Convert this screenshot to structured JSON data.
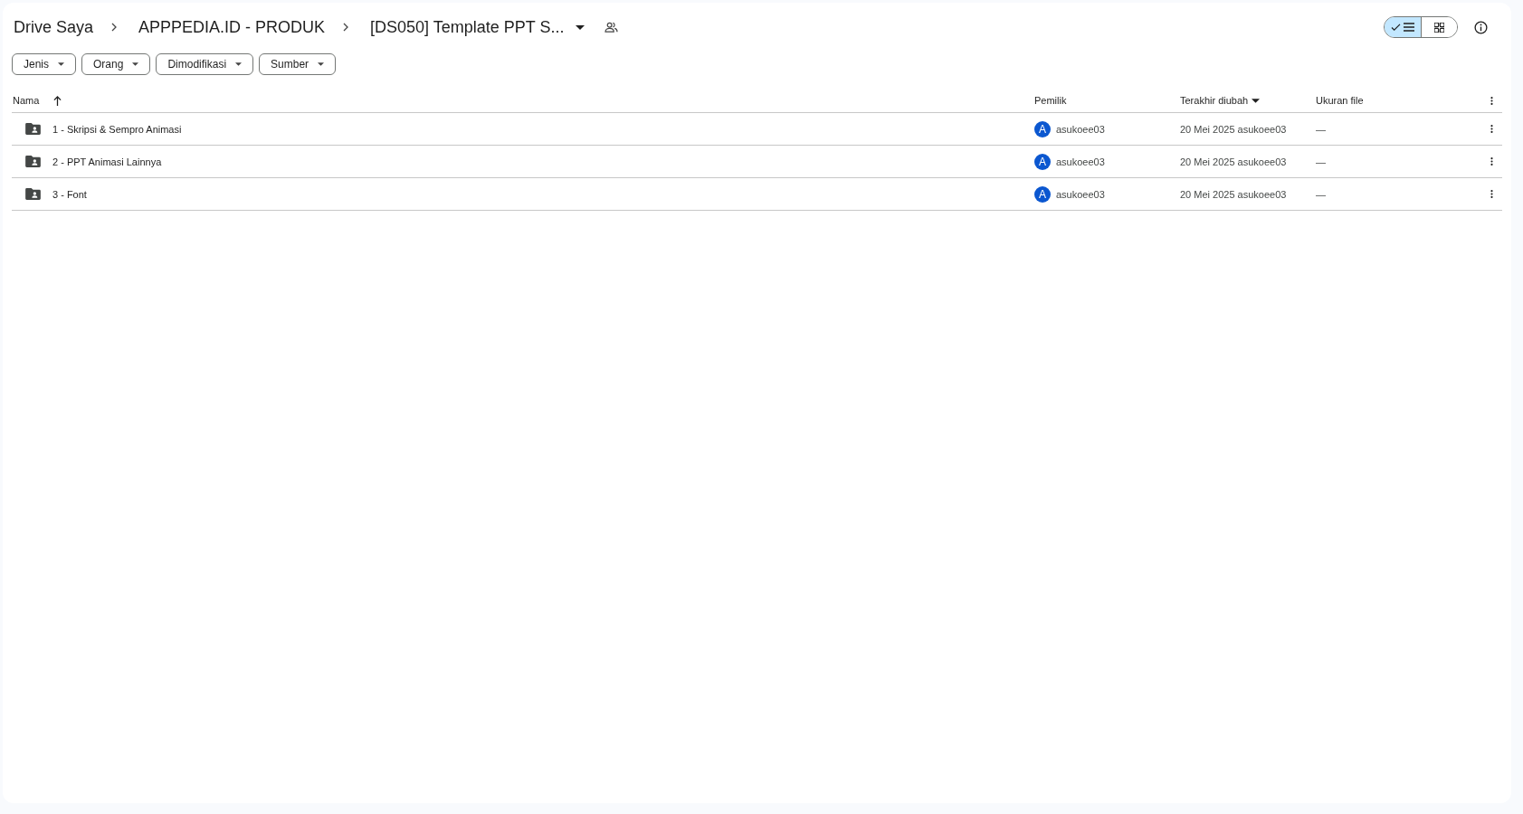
{
  "breadcrumb": [
    {
      "label": "Drive Saya",
      "menu": false
    },
    {
      "label": "APPPEDIA.ID - PRODUK",
      "menu": false
    },
    {
      "label": "[DS050] Template PPT S...",
      "menu": true
    }
  ],
  "view_toggle": [
    {
      "kind": "list",
      "selected": true
    },
    {
      "kind": "grid",
      "selected": false
    }
  ],
  "filters": [
    {
      "label": "Jenis"
    },
    {
      "label": "Orang"
    },
    {
      "label": "Dimodifikasi"
    },
    {
      "label": "Sumber"
    }
  ],
  "table": {
    "columns": [
      {
        "label": "Nama",
        "kind": "ascending"
      },
      {
        "label": "Pemilik",
        "kind": "plain"
      },
      {
        "label": "Terakhir diubah",
        "kind": "descending"
      },
      {
        "label": "Ukuran file",
        "kind": "plain"
      }
    ],
    "rows": [
      {
        "name": "1 - Skripsi & Sempro Animasi",
        "owner_initial": "A",
        "owner": "asukoee03",
        "modified": "20 Mei 2025 asukoee03",
        "size": "—"
      },
      {
        "name": "2 -  PPT Animasi Lainnya",
        "owner_initial": "A",
        "owner": "asukoee03",
        "modified": "20 Mei 2025 asukoee03",
        "size": "—"
      },
      {
        "name": "3 - Font",
        "owner_initial": "A",
        "owner": "asukoee03",
        "modified": "20 Mei 2025 asukoee03",
        "size": "—"
      }
    ]
  }
}
